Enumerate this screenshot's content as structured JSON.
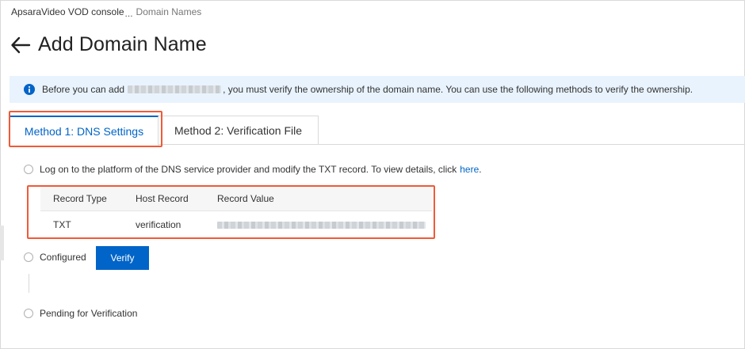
{
  "breadcrumb": {
    "root": "ApsaraVideo VOD console",
    "separator": "...",
    "current": "Domain Names"
  },
  "page": {
    "title": "Add Domain Name",
    "back_icon": "arrow-left-icon"
  },
  "notice": {
    "icon": "info-icon",
    "text_before": "Before you can add",
    "text_after": ", you must verify the ownership of the domain name. You can use the following methods to verify the ownership."
  },
  "tabs": [
    {
      "label": "Method 1: DNS Settings",
      "active": true
    },
    {
      "label": "Method 2: Verification File",
      "active": false
    }
  ],
  "steps": {
    "step1": {
      "text": "Log on to the platform of the DNS service provider and modify the TXT record. To view details, click",
      "link": "here",
      "suffix": "."
    },
    "step2": {
      "text": "Configured",
      "button": "Verify"
    },
    "step3": {
      "text": "Pending for Verification"
    }
  },
  "record_table": {
    "columns": [
      "Record Type",
      "Host Record",
      "Record Value"
    ],
    "rows": [
      {
        "type": "TXT",
        "host": "verification"
      }
    ]
  },
  "colors": {
    "accent": "#0064c8",
    "highlight": "#f05a37",
    "notice_bg": "#e9f3fd"
  }
}
